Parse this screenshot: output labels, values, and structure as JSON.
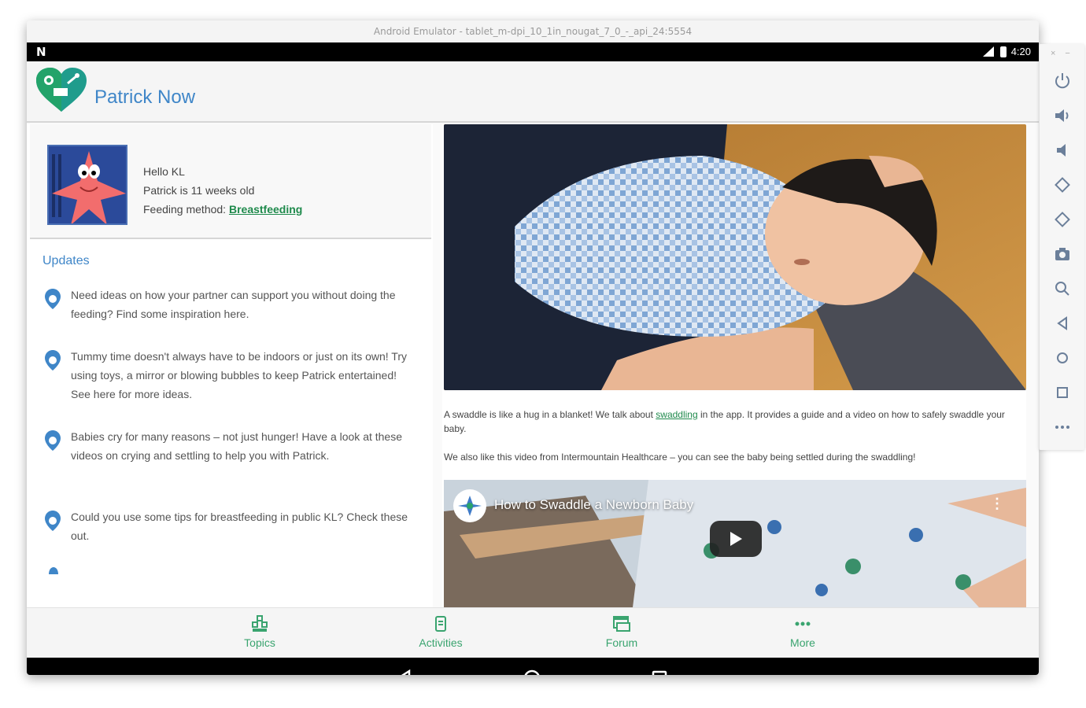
{
  "emulator": {
    "title": "Android Emulator - tablet_m-dpi_10_1in_nougat_7_0_-_api_24:5554"
  },
  "statusbar": {
    "time": "4:20"
  },
  "app": {
    "title": "Patrick Now"
  },
  "profile": {
    "greeting": "Hello KL",
    "age_line": "Patrick is 11 weeks old",
    "feeding_label": "Feeding method:",
    "feeding_value": "Breastfeeding"
  },
  "updates": {
    "title": "Updates",
    "items": [
      {
        "text": "Need ideas on how your partner can support you without doing the feeding? Find some inspiration here."
      },
      {
        "text": "Tummy time doesn't always have to be indoors or just on its own! Try using toys, a mirror or blowing bubbles to keep Patrick entertained! See here for more ideas."
      },
      {
        "text": "Babies cry for many reasons – not just hunger! Have a look at these videos on crying and settling to help you with Patrick."
      },
      {
        "text": "Could you use some tips for breastfeeding in public KL? Check these out."
      }
    ]
  },
  "article": {
    "caption1_before": "A swaddle is like a hug in a blanket! We talk about ",
    "caption1_link": "swaddling",
    "caption1_after": " in the app. It provides a guide and a video on how to safely swaddle your baby.",
    "caption2": "We also like this video from Intermountain Healthcare – you can see the baby being settled during the swaddling!",
    "video_title": "How to Swaddle a Newborn Baby"
  },
  "bottomnav": {
    "items": [
      {
        "label": "Topics",
        "icon": "topics-icon"
      },
      {
        "label": "Activities",
        "icon": "activities-icon"
      },
      {
        "label": "Forum",
        "icon": "forum-icon"
      },
      {
        "label": "More",
        "icon": "more-icon"
      }
    ]
  },
  "colors": {
    "accent_blue": "#3f86c8",
    "accent_green": "#3aa46f",
    "link_green": "#1f8a4c"
  }
}
